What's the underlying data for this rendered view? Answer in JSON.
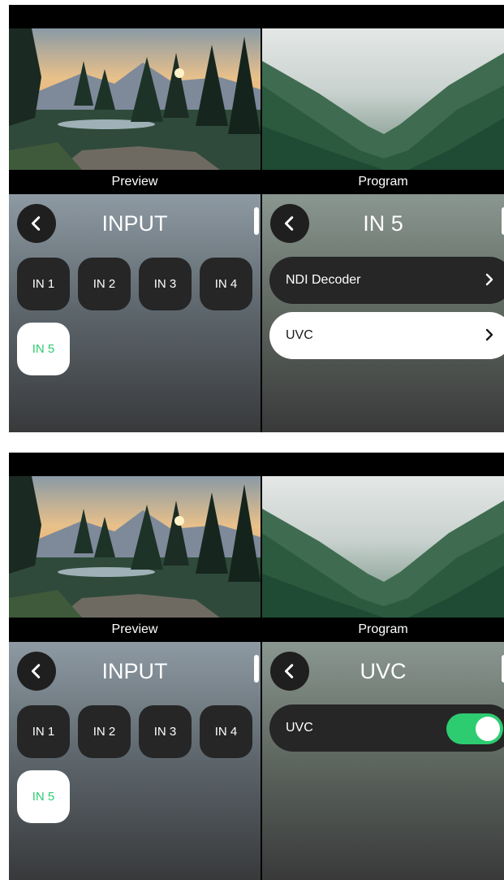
{
  "screens": [
    {
      "preview_caption": "Preview",
      "program_caption": "Program",
      "left_panel": {
        "title": "INPUT",
        "inputs": [
          {
            "label": "IN 1",
            "selected": false
          },
          {
            "label": "IN 2",
            "selected": false
          },
          {
            "label": "IN 3",
            "selected": false
          },
          {
            "label": "IN 4",
            "selected": false
          },
          {
            "label": "IN 5",
            "selected": true
          }
        ]
      },
      "right_panel": {
        "title": "IN 5",
        "items": [
          {
            "label": "NDI Decoder"
          },
          {
            "label": "UVC"
          }
        ]
      }
    },
    {
      "preview_caption": "Preview",
      "program_caption": "Program",
      "left_panel": {
        "title": "INPUT",
        "inputs": [
          {
            "label": "IN 1",
            "selected": false
          },
          {
            "label": "IN 2",
            "selected": false
          },
          {
            "label": "IN 3",
            "selected": false
          },
          {
            "label": "IN 4",
            "selected": false
          },
          {
            "label": "IN 5",
            "selected": true
          }
        ]
      },
      "right_panel": {
        "title": "UVC",
        "toggle": {
          "label": "UVC",
          "on": true
        }
      }
    }
  ],
  "colors": {
    "accent_green": "#2ecc71",
    "button_dark": "#262626",
    "selected_tile_bg": "#ffffff"
  },
  "icons": {
    "back": "chevron-left-icon",
    "row_arrow": "chevron-right-icon"
  }
}
